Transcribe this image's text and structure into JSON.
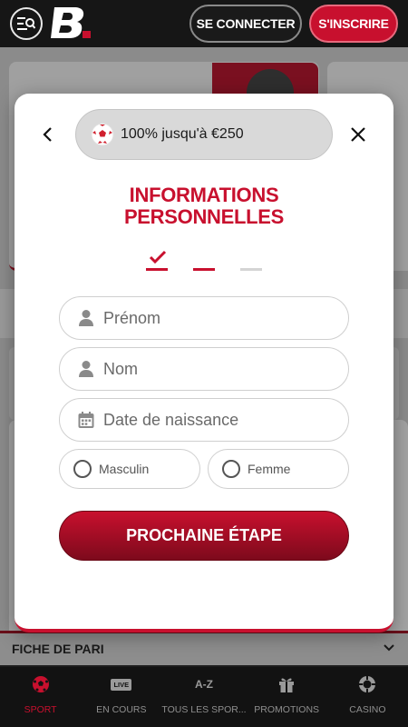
{
  "header": {
    "login_label": "SE CONNECTER",
    "signup_label": "S'INSCRIRE"
  },
  "modal": {
    "promo_text": "100% jusqu'à €250",
    "title_line1": "INFORMATIONS",
    "title_line2": "PERSONNELLES",
    "steps": {
      "current": 2,
      "total": 3
    },
    "fields": {
      "first_name_placeholder": "Prénom",
      "last_name_placeholder": "Nom",
      "birthdate_placeholder": "Date de naissance"
    },
    "gender": {
      "male_label": "Masculin",
      "female_label": "Femme"
    },
    "next_label": "PROCHAINE ÉTAPE"
  },
  "betslip": {
    "label": "FICHE DE PARI"
  },
  "bottom_nav": {
    "items": [
      {
        "label": "SPORT",
        "icon": "soccer-ball-icon",
        "active": true
      },
      {
        "label": "EN COURS",
        "icon": "live-icon",
        "active": false
      },
      {
        "label": "TOUS LES SPOR...",
        "icon": "az-icon",
        "active": false
      },
      {
        "label": "PROMOTIONS",
        "icon": "gift-icon",
        "active": false
      },
      {
        "label": "CASINO",
        "icon": "casino-chip-icon",
        "active": false
      }
    ]
  },
  "colors": {
    "brand_red": "#c8102e",
    "header_bg": "#161616",
    "nav_bg": "#121212"
  }
}
